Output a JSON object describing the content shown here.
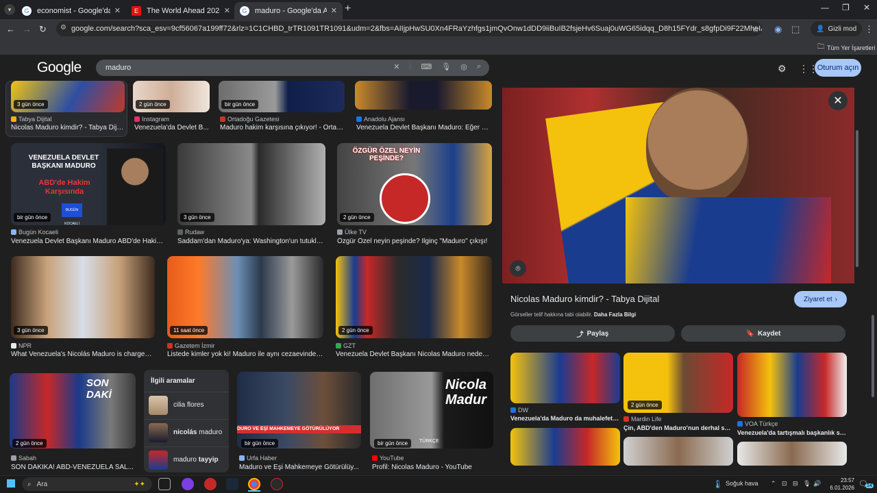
{
  "browser": {
    "tabs": [
      {
        "label": "economist - Google'da Ara",
        "icon": "google-g-icon",
        "active": false
      },
      {
        "label": "The World Ahead 2026",
        "icon": "economist-e-icon",
        "active": false
      },
      {
        "label": "maduro - Google'da Ara",
        "icon": "google-g-icon",
        "active": true
      }
    ],
    "url": "google.com/search?sca_esv=9cf56067a199ff72&rlz=1C1CHBD_trTR1091TR1091&udm=2&fbs=AIIjpHwSU0Xn4FRaYzhfgs1jmQvOnw1dDD9iiBuIB2fsjeHv6Suaj0uWG65idqq_D8h15FYdr_s8gfpDi9F22MheIAWr-gOHRhtjIkztZoPFSqA6_Kq90lc...",
    "incognito_label": "Gizli mod",
    "bookmarks_label": "Tüm Yer İşaretleri"
  },
  "google": {
    "logo": "Google",
    "query": "maduro",
    "signin_label": "Oturum açın"
  },
  "results": [
    {
      "ago": "3 gün önce",
      "source": "Tabya Dijital",
      "title": "Nicolas Maduro kimdir? - Tabya Dijital",
      "fav": "#f4b400"
    },
    {
      "ago": "2 gün önce",
      "source": "Instagram",
      "title": "Venezuela'da Devlet B...",
      "fav": "#e1306c"
    },
    {
      "ago": "bir gün önce",
      "source": "Ortadoğu Gazetesi",
      "title": "Maduro hakim karşısına çıkıyor! - Ortad...",
      "fav": "#c0392b"
    },
    {
      "ago": "",
      "source": "Anadolu Ajansı",
      "title": "Venezuela Devlet Başkanı Maduro: Eğer sil...",
      "fav": "#1a73e8"
    },
    {
      "ago": "bir gün önce",
      "source": "Bugün Kocaeli",
      "title": "Venezuela Devlet Başkanı Maduro ABD'de Hakim ...",
      "fav": "#8ab4f8"
    },
    {
      "ago": "3 gün önce",
      "source": "Rudaw",
      "title": "Saddam'dan Maduro'ya: Washington'un tutukla...",
      "fav": "#5f6368"
    },
    {
      "ago": "2 gün önce",
      "source": "Ülke TV",
      "title": "Özgür Özel neyin peşinde? İlginç \"Maduro\" çıkışı!",
      "fav": "#9aa0a6"
    },
    {
      "ago": "3 gün önce",
      "source": "NPR",
      "title": "What Venezuela's Nicolás Maduro is charged ...",
      "fav": "#e8eaed"
    },
    {
      "ago": "11 saat önce",
      "source": "Gazetem İzmir",
      "title": "Listede kimler yok ki! Maduro ile aynı cezaevinde k...",
      "fav": "#d93025"
    },
    {
      "ago": "2 gün önce",
      "source": "GZT",
      "title": "Venezuela Devlet Başkanı Nicolas Maduro neden ...",
      "fav": "#34a853"
    },
    {
      "ago": "2 gün önce",
      "source": "Sabah",
      "title": "SON DAKİKA! ABD-VENEZUELA SAL...",
      "fav": "#9aa0a6"
    },
    {
      "ago": "bir gün önce",
      "source": "Urfa Haber",
      "title": "Maduro ve Eşi Mahkemeye Götürülüy...",
      "fav": "#8ab4f8"
    },
    {
      "ago": "bir gün önce",
      "source": "YouTube",
      "title": "Profil: Nicolas Maduro - YouTube",
      "fav": "#ff0000"
    }
  ],
  "thumb_texts": {
    "r5": "VENEZUELA DEVLET BAŞKANI MADURO",
    "r5b": "ABD'de Hakim Karşısında",
    "r5c": "BUGÜN KOCAELİ",
    "r7": "ÖZGÜR ÖZEL NEYİN PEŞİNDE?",
    "r11": "SON DAKİ",
    "r12": "DURO VE EŞİ MAHKEMEYE GÖTÜRÜLÜYOR",
    "r13": "Nicola Madur",
    "r13b": "TÜRKÇE"
  },
  "related": {
    "heading": "İlgili aramalar",
    "items": [
      {
        "pre": "cilia flores",
        "bold": ""
      },
      {
        "pre": "",
        "bold": "nicolás",
        "post": " maduro"
      },
      {
        "pre": "maduro ",
        "bold": "tayyip"
      }
    ]
  },
  "panel": {
    "title": "Nicolas Maduro kimdir? - Tabya Dijital",
    "visit_label": "Ziyaret et",
    "copyright": "Görseller telif hakkına tabi olabilir.",
    "more_info": "Daha Fazla Bilgi",
    "share_label": "Paylaş",
    "save_label": "Kaydet",
    "similar": [
      {
        "ago": "",
        "source": "DW",
        "title": "Venezuela'da Maduro da muhalefet de...",
        "fav": "#1a73e8"
      },
      {
        "ago": "2 gün önce",
        "source": "Mardin Life",
        "title": "Çin, ABD'den Maduro'nun derhal serbe...",
        "fav": "#d93025"
      },
      {
        "ago": "",
        "source": "VOA Türkçe",
        "title": "Venezuela'da tartışmalı başkanlık seçi...",
        "fav": "#1a73e8"
      }
    ]
  },
  "taskbar": {
    "search_label": "Ara",
    "weather": "Soğuk hava",
    "time": "23:57",
    "date": "6.01.2026",
    "notif_count": "14"
  }
}
